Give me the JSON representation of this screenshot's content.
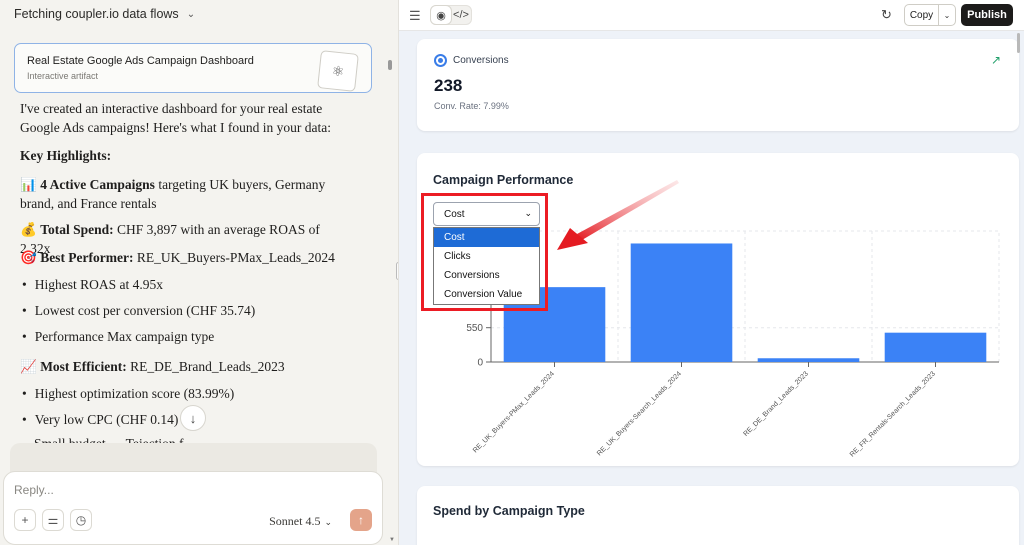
{
  "left_panel": {
    "header_title": "Fetching coupler.io data flows",
    "artifact": {
      "title": "Real Estate Google Ads Campaign Dashboard",
      "subtitle": "Interactive artifact"
    },
    "intro": "I've created an interactive dashboard for your real estate Google Ads campaigns! Here's what I found in your data:",
    "key_highlights": "Key Highlights:",
    "active": {
      "emoji": "📊",
      "bold": "4 Active Campaigns",
      "rest": " targeting UK buyers, Germany brand, and France rentals"
    },
    "spend": {
      "emoji": "💰",
      "bold": "Total Spend:",
      "rest": " CHF 3,897 with an average ROAS of 2.32x"
    },
    "best": {
      "emoji": "🎯",
      "bold": "Best Performer:",
      "rest": " RE_UK_Buyers-PMax_Leads_2024"
    },
    "best_bullets": [
      "Highest ROAS at 4.95x",
      "Lowest cost per conversion (CHF 35.74)",
      "Performance Max campaign type"
    ],
    "efficient": {
      "emoji": "📈",
      "bold": "Most Efficient:",
      "rest": " RE_DE_Brand_Leads_2023"
    },
    "efficient_bullets": [
      "Highest optimization score (83.99%)",
      "Very low CPC (CHF 0.14)"
    ],
    "cut_line": "Small budget … Tejection f…",
    "composer": {
      "placeholder": "Reply...",
      "model": "Sonnet 4.5"
    }
  },
  "toolbar": {
    "copy_label": "Copy",
    "publish_label": "Publish"
  },
  "conversions_card": {
    "title": "Conversions",
    "value": "238",
    "rate": "Conv. Rate: 7.99%"
  },
  "performance_card": {
    "title": "Campaign Performance",
    "selected_metric": "Cost",
    "options": [
      "Cost",
      "Clicks",
      "Conversions",
      "Conversion Value"
    ]
  },
  "spend_card": {
    "title": "Spend by Campaign Type"
  },
  "colors": {
    "bar": "#3b82f6",
    "highlight": "#ec1c24",
    "select_highlight": "#1e6bd6"
  },
  "chart_data": {
    "type": "bar",
    "categories": [
      "RE_UK_Buyers-PMax_Leads_2024",
      "RE_UK_Buyers-Search_Leads_2024",
      "RE_DE_Brand_Leads_2023",
      "RE_FR_Rentals-Search_Leads_2023"
    ],
    "values": [
      1200,
      1900,
      60,
      470
    ],
    "y_ticks": [
      0,
      550
    ],
    "ylim": [
      0,
      2100
    ],
    "grid": true
  }
}
